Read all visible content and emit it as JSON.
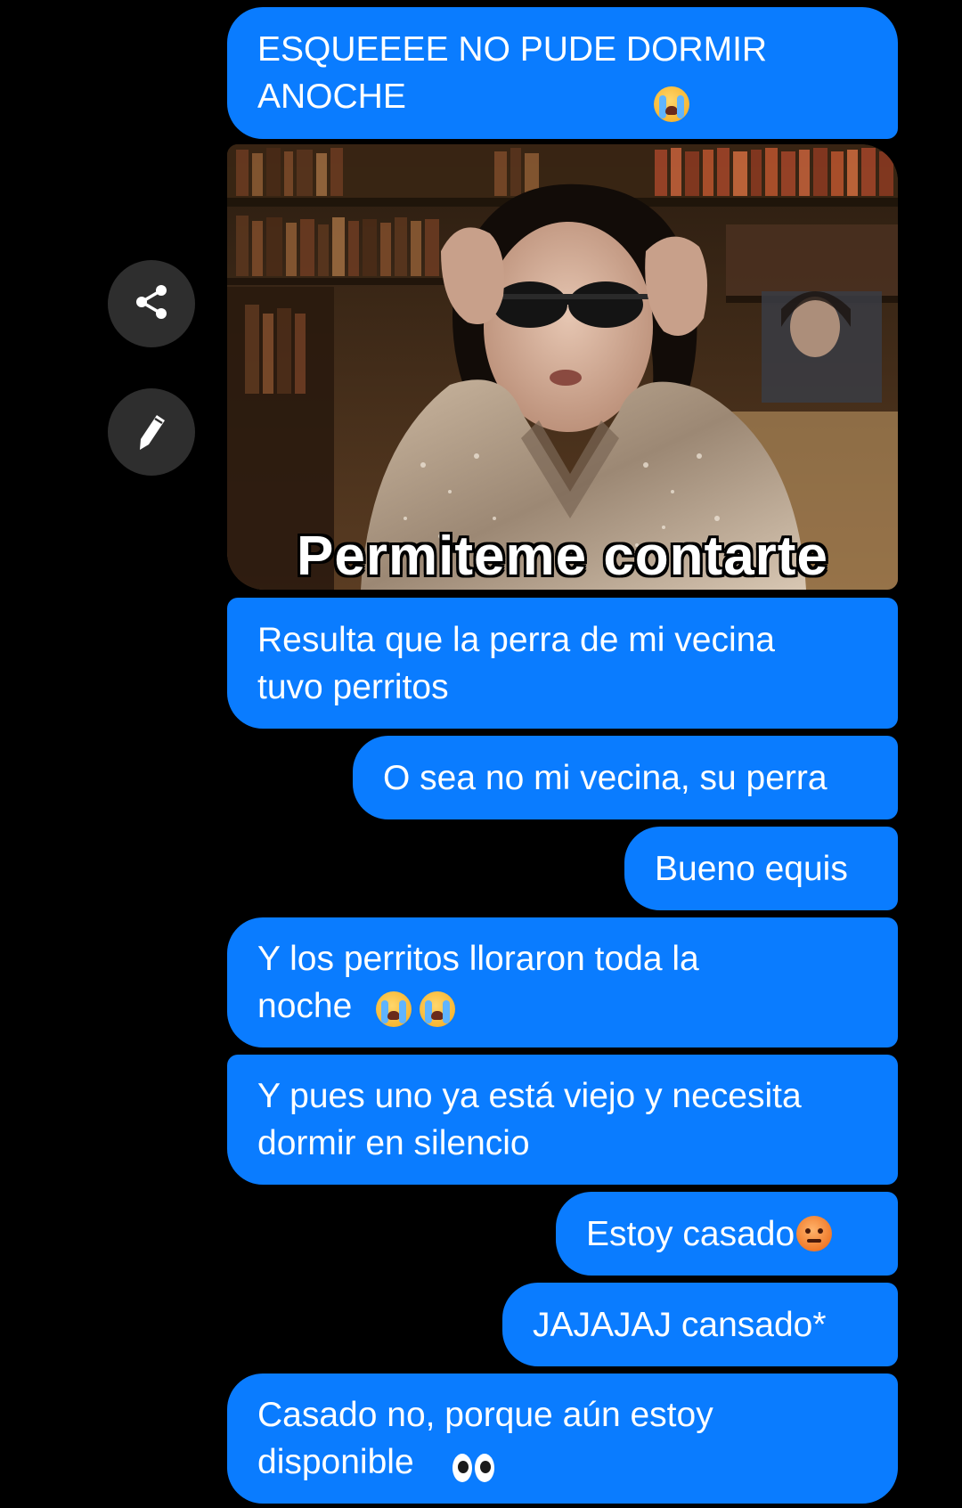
{
  "messages": [
    {
      "id": "m1",
      "text": "ESQUEEEE NO PUDE DORMIR\nANOCHE",
      "emoji": [
        "loudly-crying-face"
      ]
    },
    {
      "id": "m2",
      "type": "image",
      "caption": "Permiteme contarte"
    },
    {
      "id": "m3",
      "text": "Resulta que la perra de mi vecina\ntuvo perritos"
    },
    {
      "id": "m4",
      "text": "O sea no mi vecina, su perra"
    },
    {
      "id": "m5",
      "text": "Bueno equis"
    },
    {
      "id": "m6",
      "text": "Y los perritos lloraron toda la\nnoche",
      "emoji": [
        "loudly-crying-face",
        "loudly-crying-face"
      ]
    },
    {
      "id": "m7",
      "text": "Y pues uno ya está viejo y necesita\ndormir en silencio"
    },
    {
      "id": "m8",
      "text": "Estoy casado",
      "emoji": [
        "angry-face"
      ]
    },
    {
      "id": "m9",
      "text": "JAJAJAJ cansado*"
    },
    {
      "id": "m10",
      "text": "Casado no, porque aún estoy\ndisponible",
      "emoji": [
        "eyes"
      ]
    }
  ],
  "actions": {
    "share_icon": "share-icon",
    "edit_icon": "pencil-icon"
  },
  "colors": {
    "background": "#000000",
    "bubble": "#0a7cff",
    "bubble_text": "#ffffff",
    "action_button": "#2e2e2e"
  }
}
